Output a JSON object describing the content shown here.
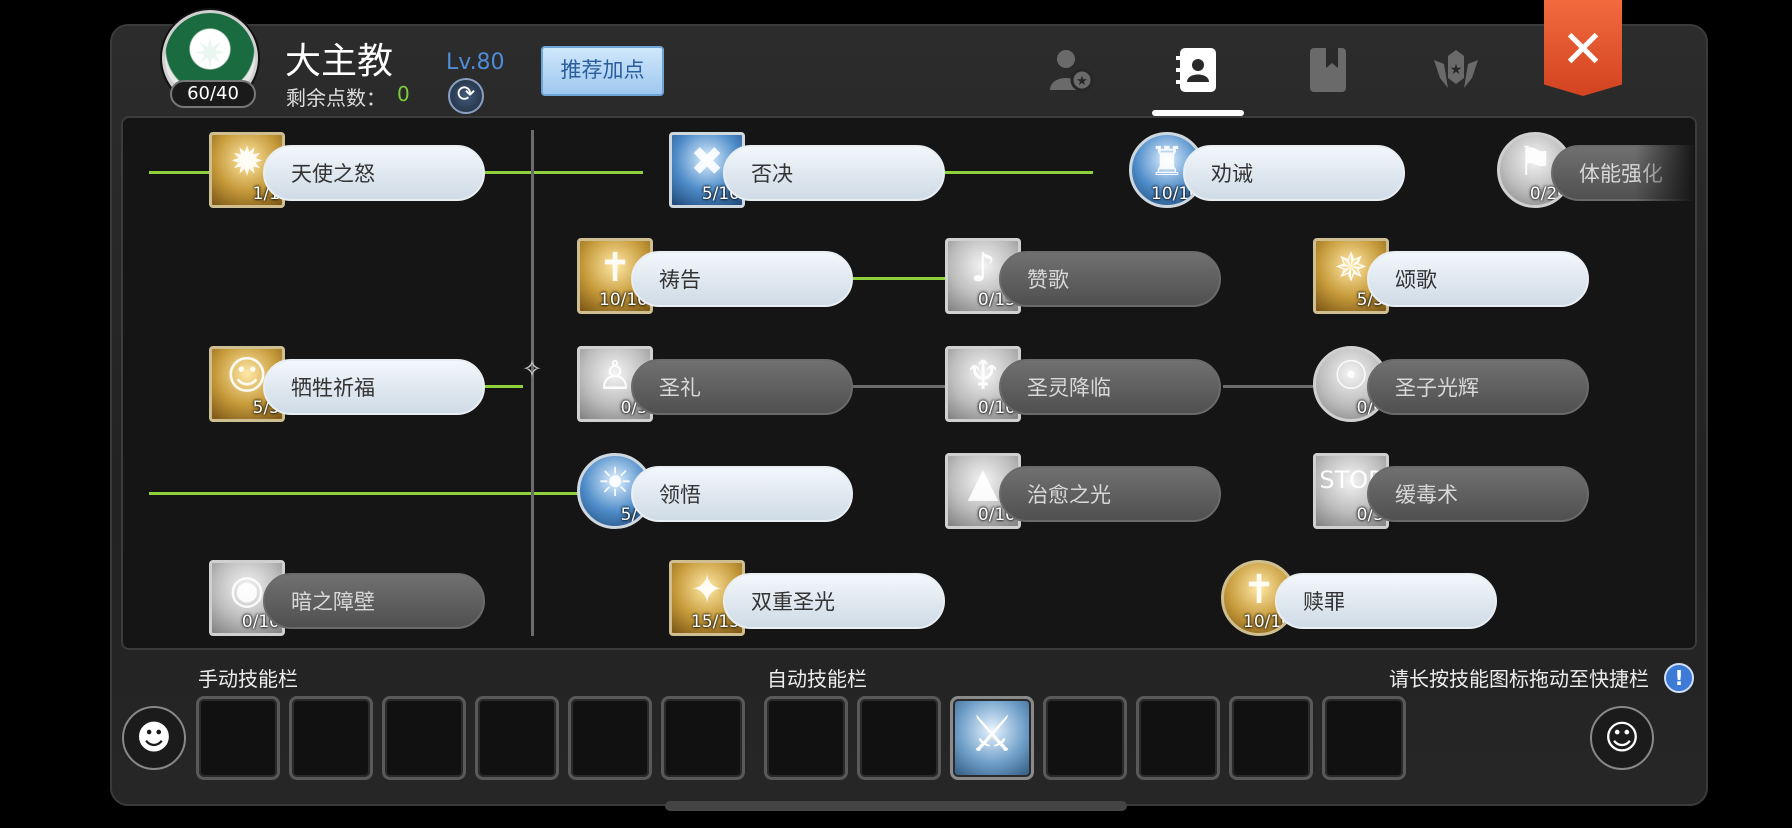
{
  "header": {
    "class_name": "大主教",
    "emblem_count": "60/40",
    "level": "Lv.80",
    "points_label": "剩余点数：",
    "points_value": "0",
    "recommend_label": "推荐加点",
    "tabs": [
      "person-star-icon",
      "contact-book-icon",
      "bookmark-book-icon",
      "emblem-star-icon"
    ],
    "active_tab": 1,
    "close_glyph": "✕"
  },
  "skills": [
    {
      "name": "天使之怒",
      "level": "1/1",
      "active": true,
      "glyph": "✹"
    },
    {
      "name": "否决",
      "level": "5/10",
      "active": true,
      "glyph": "✖"
    },
    {
      "name": "劝诫",
      "level": "10/10",
      "active": true,
      "glyph": "♜"
    },
    {
      "name": "体能强化",
      "level": "0/20",
      "active": false,
      "glyph": "⚑"
    },
    {
      "name": "祷告",
      "level": "10/10",
      "active": true,
      "glyph": "✝"
    },
    {
      "name": "赞歌",
      "level": "0/15",
      "active": false,
      "glyph": "♪"
    },
    {
      "name": "颂歌",
      "level": "5/5",
      "active": true,
      "glyph": "✵"
    },
    {
      "name": "牺牲祈福",
      "level": "5/5",
      "active": true,
      "glyph": "☺"
    },
    {
      "name": "圣礼",
      "level": "0/5",
      "active": false,
      "glyph": "♙"
    },
    {
      "name": "圣灵降临",
      "level": "0/10",
      "active": false,
      "glyph": "♆"
    },
    {
      "name": "圣子光辉",
      "level": "0/6",
      "active": false,
      "glyph": "☉"
    },
    {
      "name": "领悟",
      "level": "5/5",
      "active": true,
      "glyph": "☀"
    },
    {
      "name": "治愈之光",
      "level": "0/10",
      "active": false,
      "glyph": "▲"
    },
    {
      "name": "缓毒术",
      "level": "0/3",
      "active": false,
      "glyph": "STOP"
    },
    {
      "name": "暗之障壁",
      "level": "0/10",
      "active": false,
      "glyph": "◉"
    },
    {
      "name": "双重圣光",
      "level": "15/15",
      "active": true,
      "glyph": "✦"
    },
    {
      "name": "赎罪",
      "level": "10/10",
      "active": true,
      "glyph": "✝"
    }
  ],
  "bars": {
    "manual_label": "手动技能栏",
    "auto_label": "自动技能栏",
    "hint": "请长按技能图标拖动至快捷栏",
    "info_glyph": "!",
    "mascot_left": "☻",
    "mascot_right": "☺",
    "auto_filled_glyph": "⚔"
  },
  "colors": {
    "active_line": "#8fd13b",
    "inactive_line": "#6b6b6b",
    "accent_blue": "#4f8cd8",
    "close_red": "#e0532c"
  }
}
